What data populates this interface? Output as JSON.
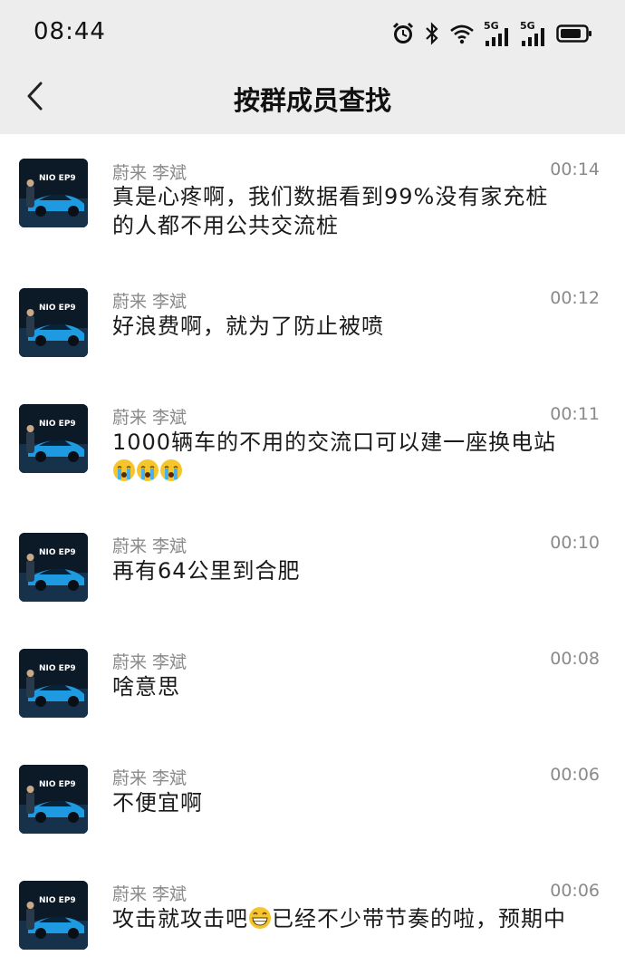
{
  "status_bar": {
    "time": "08:44",
    "icons": [
      "alarm-icon",
      "bluetooth-icon",
      "wifi-icon",
      "signal-5g-icon",
      "signal-5g-icon",
      "battery-icon"
    ],
    "network_labels": [
      "5G",
      "5G"
    ]
  },
  "header": {
    "title": "按群成员查找",
    "back_icon": "chevron-left-icon"
  },
  "avatar_brand": "NIO EP9",
  "messages": [
    {
      "sender": "蔚来 李斌",
      "time": "00:14",
      "line1": "真是心疼啊，我们数据看到99%没有家充桩",
      "line2": "的人都不用公共交流桩"
    },
    {
      "sender": "蔚来 李斌",
      "time": "00:12",
      "line1": "好浪费啊，就为了防止被喷"
    },
    {
      "sender": "蔚来 李斌",
      "time": "00:11",
      "line1": "1000辆车的不用的交流口可以建一座换电站",
      "emoji": "crying-face-emoji"
    },
    {
      "sender": "蔚来 李斌",
      "time": "00:10",
      "line1": "再有64公里到合肥"
    },
    {
      "sender": "蔚来 李斌",
      "time": "00:08",
      "line1": "啥意思"
    },
    {
      "sender": "蔚来 李斌",
      "time": "00:06",
      "line1": "不便宜啊"
    },
    {
      "sender": "蔚来 李斌",
      "time": "00:06",
      "line1_a": "攻击就攻击吧",
      "line1_b": "已经不少带节奏的啦，预期中",
      "emoji": "grinning-face-emoji"
    }
  ]
}
